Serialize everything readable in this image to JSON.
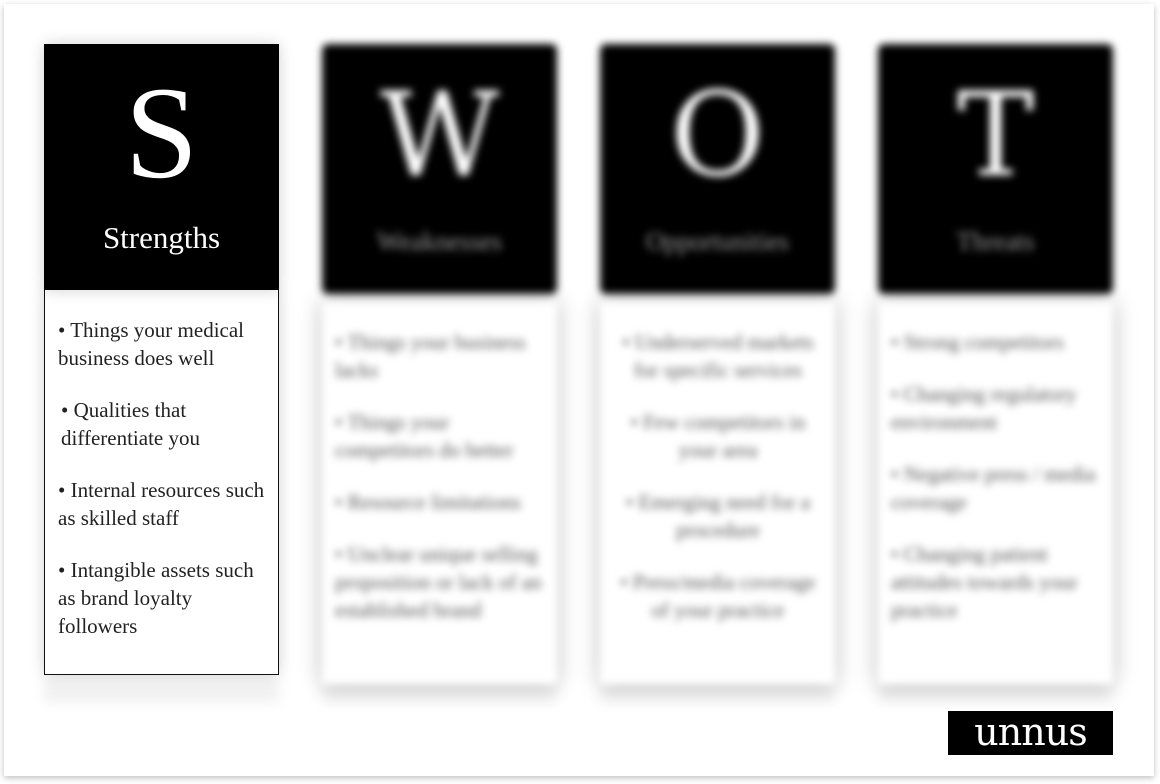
{
  "columns": [
    {
      "letter": "S",
      "heading": "Strengths",
      "items": [
        "• Things your medical business does well",
        "• Qualities that differentiate you",
        "• Internal resources such as skilled staff",
        "• Intangible assets such as brand loyalty followers"
      ]
    },
    {
      "letter": "W",
      "heading": "Weaknesses",
      "items": [
        "• Things your business lacks",
        "• Things your competitors do better",
        "• Resource limitations",
        "• Unclear unique selling proposition or lack of an established brand"
      ]
    },
    {
      "letter": "O",
      "heading": "Opportunities",
      "items": [
        "• Underserved markets for specific services",
        "• Few competitors in your area",
        "• Emerging need for a procedure",
        "• Press/media coverage of your practice"
      ]
    },
    {
      "letter": "T",
      "heading": "Threats",
      "items": [
        "• Strong competitors",
        "• Changing regulatory environment",
        "• Negative press / media coverage",
        "• Changing patient attitudes towards your practice"
      ]
    }
  ],
  "logo": {
    "text": "unnus"
  }
}
